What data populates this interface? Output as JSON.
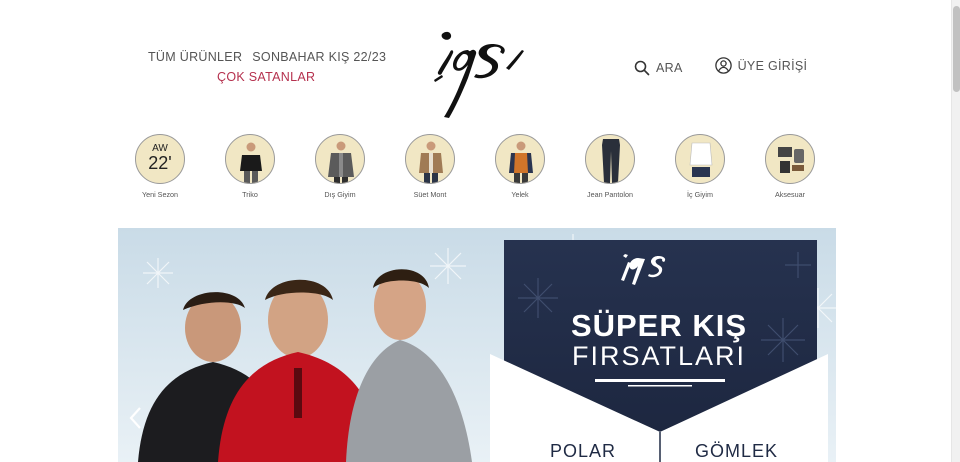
{
  "header": {
    "nav_left": {
      "all_products": "TÜM ÜRÜNLER",
      "season": "SONBAHAR KIŞ 22/23",
      "best_sellers": "ÇOK SATANLAR"
    },
    "logo_text": "igs",
    "nav_right": {
      "search_label": "ARA",
      "login_label": "ÜYE GİRİŞİ"
    }
  },
  "categories": [
    {
      "label": "Yeni Sezon",
      "badge_line1": "AW",
      "badge_line2": "22'"
    },
    {
      "label": "Triko"
    },
    {
      "label": "Dış Giyim"
    },
    {
      "label": "Süet Mont"
    },
    {
      "label": "Yelek"
    },
    {
      "label": "Jean Pantolon"
    },
    {
      "label": "İç Giyim"
    },
    {
      "label": "Aksesuar"
    }
  ],
  "hero": {
    "brand": "igs",
    "title_line1": "SÜPER KIŞ",
    "title_line2": "FIRSATLARI",
    "tabs": [
      "POLAR",
      "GÖMLEK"
    ]
  },
  "colors": {
    "accent": "#b5314e",
    "hero_navy": "#1f2a44",
    "category_bg": "#f1e7c4"
  }
}
